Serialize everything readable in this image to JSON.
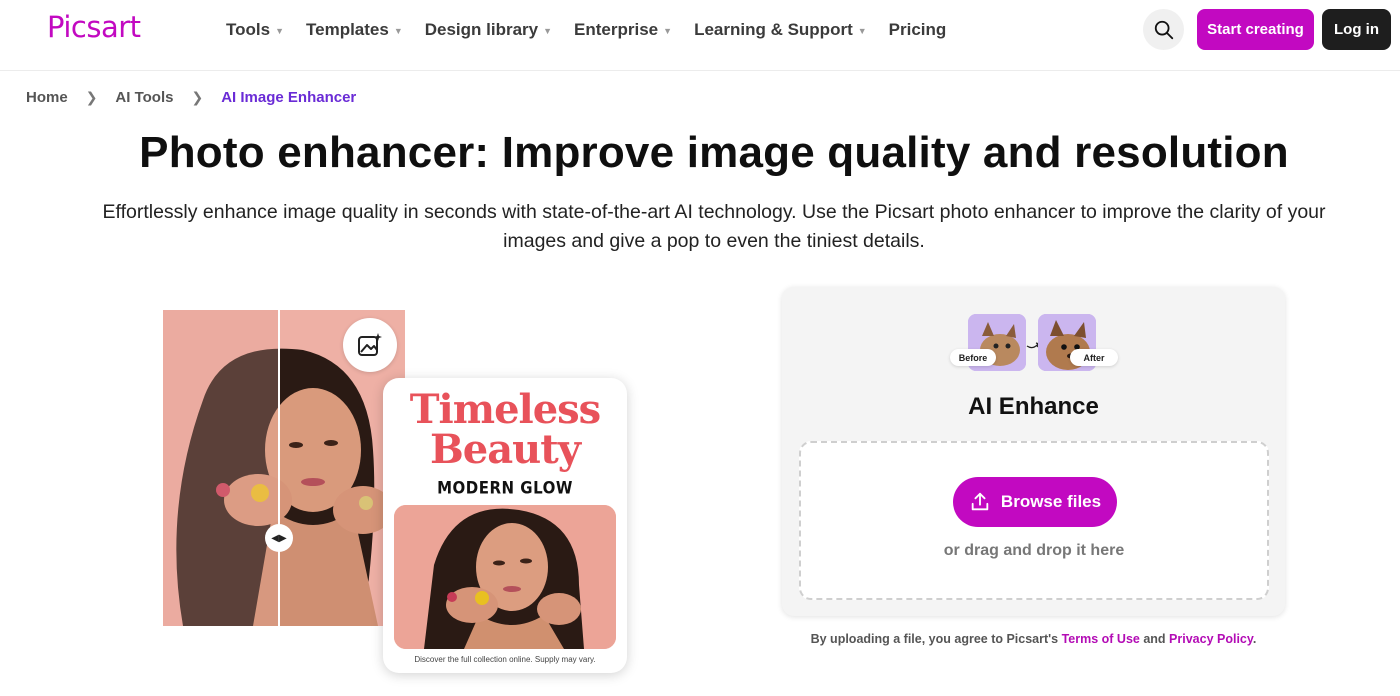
{
  "header": {
    "logo": "Picsart",
    "nav": [
      {
        "label": "Tools",
        "has_dropdown": true
      },
      {
        "label": "Templates",
        "has_dropdown": true
      },
      {
        "label": "Design library",
        "has_dropdown": true
      },
      {
        "label": "Enterprise",
        "has_dropdown": true
      },
      {
        "label": "Learning & Support",
        "has_dropdown": true
      },
      {
        "label": "Pricing",
        "has_dropdown": false
      }
    ],
    "search_icon": "search-icon",
    "start_label": "Start creating",
    "login_label": "Log in",
    "accent": "#c209c1"
  },
  "breadcrumb": {
    "items": [
      "Home",
      "AI Tools",
      "AI Image Enhancer"
    ],
    "separator_icon": "chevron-right-icon",
    "active_color": "#6a2bd6"
  },
  "hero": {
    "title": "Photo enhancer: Improve image quality and resolution",
    "subtitle": "Effortlessly enhance image quality in seconds with state-of-the-art AI technology. Use the Picsart photo enhancer to improve the clarity of your images and give a pop to even the tiniest details."
  },
  "showcase": {
    "badge_icon": "image-sparkle-icon",
    "compare_handle_icon": "left-right-arrows-icon",
    "poster_title_line1": "Timeless",
    "poster_title_line2": "Beauty",
    "poster_subtitle": "MODERN GLOW",
    "poster_note": "Discover the full collection online. Supply may vary."
  },
  "upload": {
    "before_label": "Before",
    "after_label": "After",
    "title": "AI Enhance",
    "browse_label": "Browse files",
    "browse_icon": "upload-icon",
    "drag_text": "or drag and drop it here"
  },
  "terms": {
    "prefix": "By uploading a file, you agree to Picsart's",
    "terms_link": "Terms of Use",
    "and": "and",
    "privacy_link": "Privacy Policy",
    "suffix": "."
  }
}
